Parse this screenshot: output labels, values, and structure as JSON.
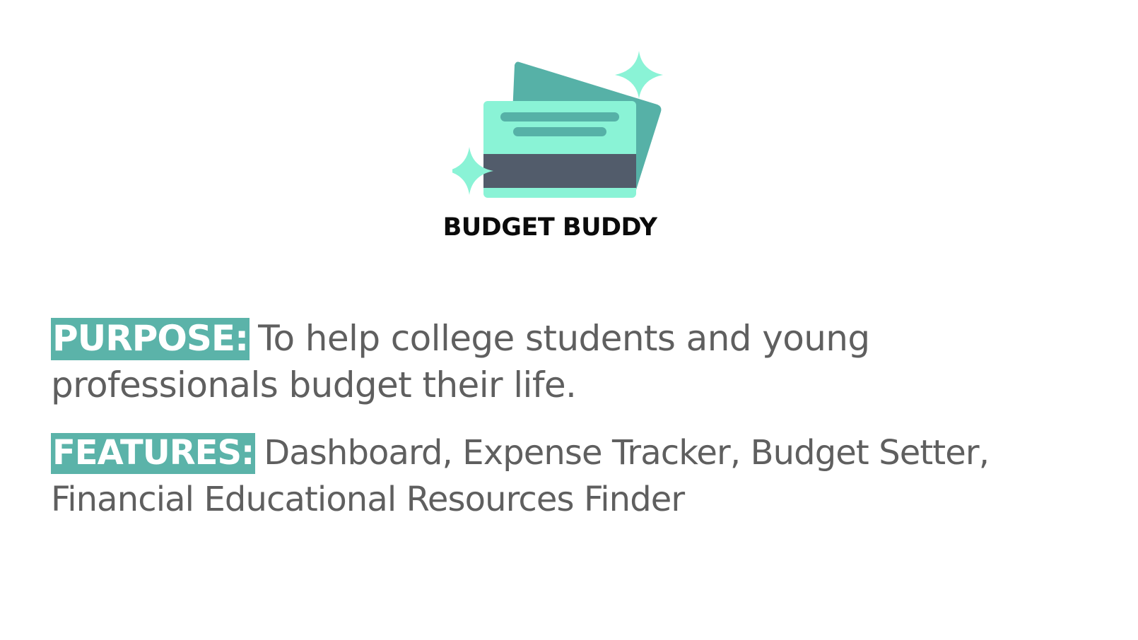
{
  "logo": {
    "icon_name": "credit-cards-sparkle-icon",
    "brand_name": "BUDGET BUDDY"
  },
  "colors": {
    "highlight": "#5bb3a9",
    "card_back": "#56b1a7",
    "card_front": "#8af3d6",
    "card_stripe": "#525c6b",
    "sparkle": "#8af3d6",
    "body_text": "#5f5f5f"
  },
  "purpose": {
    "label": "PURPOSE:",
    "text": "To help college students and young professionals budget their life."
  },
  "features": {
    "label": "FEATURES:",
    "text": "Dashboard, Expense Tracker, Budget Setter, Financial Educational Resources Finder"
  }
}
